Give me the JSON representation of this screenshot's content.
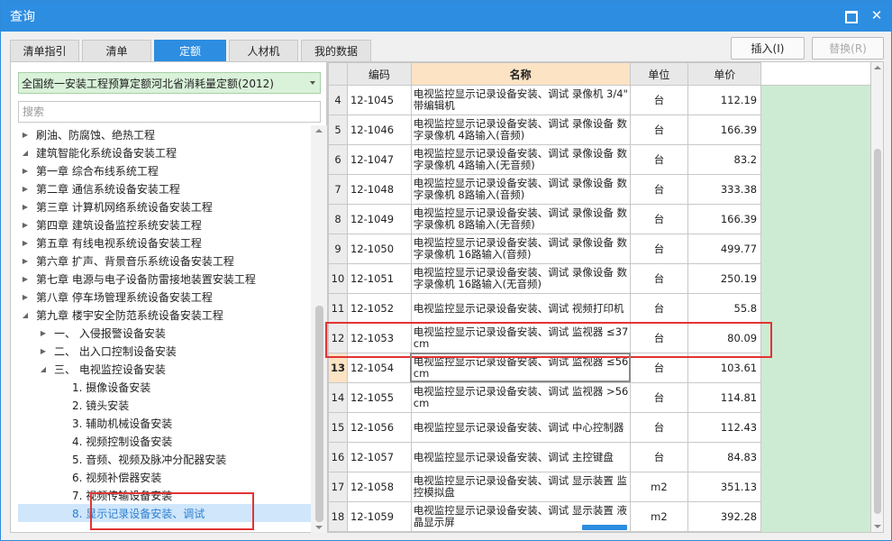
{
  "window": {
    "title": "查询"
  },
  "tabs": [
    "清单指引",
    "清单",
    "定额",
    "人材机",
    "我的数据"
  ],
  "buttons": {
    "insert": "插入(I)",
    "replace": "替换(R)"
  },
  "left": {
    "combo_value": "全国统一安装工程预算定额河北省消耗量定额(2012)",
    "search_placeholder": "搜索",
    "tree": [
      {
        "label": "刷油、防腐蚀、绝热工程",
        "level": 0,
        "expanded": false
      },
      {
        "label": "建筑智能化系统设备安装工程",
        "level": 0,
        "expanded": true
      },
      {
        "label": "第一章 综合布线系统工程",
        "level": 1,
        "expanded": false
      },
      {
        "label": "第二章 通信系统设备安装工程",
        "level": 1,
        "expanded": false
      },
      {
        "label": "第三章 计算机网络系统设备安装工程",
        "level": 1,
        "expanded": false
      },
      {
        "label": "第四章 建筑设备监控系统安装工程",
        "level": 1,
        "expanded": false
      },
      {
        "label": "第五章 有线电视系统设备安装工程",
        "level": 1,
        "expanded": false
      },
      {
        "label": "第六章 扩声、背景音乐系统设备安装工程",
        "level": 1,
        "expanded": false
      },
      {
        "label": "第七章 电源与电子设备防雷接地装置安装工程",
        "level": 1,
        "expanded": false
      },
      {
        "label": "第八章 停车场管理系统设备安装工程",
        "level": 1,
        "expanded": false
      },
      {
        "label": "第九章 楼宇安全防范系统设备安装工程",
        "level": 1,
        "expanded": true
      },
      {
        "label": "一、 入侵报警设备安装",
        "level": 2,
        "expanded": false
      },
      {
        "label": "二、 出入口控制设备安装",
        "level": 2,
        "expanded": false
      },
      {
        "label": "三、 电视监控设备安装",
        "level": 2,
        "expanded": true
      },
      {
        "label": "1. 摄像设备安装",
        "level": 3,
        "leaf": true
      },
      {
        "label": "2. 镜头安装",
        "level": 3,
        "leaf": true
      },
      {
        "label": "3. 辅助机械设备安装",
        "level": 3,
        "leaf": true
      },
      {
        "label": "4. 视频控制设备安装",
        "level": 3,
        "leaf": true
      },
      {
        "label": "5. 音频、视频及脉冲分配器安装",
        "level": 3,
        "leaf": true
      },
      {
        "label": "6. 视频补偿器安装",
        "level": 3,
        "leaf": true
      },
      {
        "label": "7. 视频传输设备安装",
        "level": 3,
        "leaf": true
      },
      {
        "label": "8. 显示记录设备安装、调试",
        "level": 3,
        "leaf": true,
        "selected": true
      }
    ]
  },
  "grid": {
    "headers": {
      "idx": "",
      "code": "编码",
      "name": "名称",
      "unit": "单位",
      "price": "单价"
    },
    "rows": [
      {
        "idx": "4",
        "code": "12-1045",
        "name": "电视监控显示记录设备安装、调试 录像机 3/4\" 带编辑机",
        "unit": "台",
        "price": "112.19"
      },
      {
        "idx": "5",
        "code": "12-1046",
        "name": "电视监控显示记录设备安装、调试 录像设备 数字录像机 4路输入(音频)",
        "unit": "台",
        "price": "166.39"
      },
      {
        "idx": "6",
        "code": "12-1047",
        "name": "电视监控显示记录设备安装、调试 录像设备 数字录像机 4路输入(无音频)",
        "unit": "台",
        "price": "83.2"
      },
      {
        "idx": "7",
        "code": "12-1048",
        "name": "电视监控显示记录设备安装、调试 录像设备 数字录像机 8路输入(音频)",
        "unit": "台",
        "price": "333.38"
      },
      {
        "idx": "8",
        "code": "12-1049",
        "name": "电视监控显示记录设备安装、调试 录像设备 数字录像机 8路输入(无音频)",
        "unit": "台",
        "price": "166.39"
      },
      {
        "idx": "9",
        "code": "12-1050",
        "name": "电视监控显示记录设备安装、调试 录像设备 数字录像机 16路输入(音频)",
        "unit": "台",
        "price": "499.77"
      },
      {
        "idx": "10",
        "code": "12-1051",
        "name": "电视监控显示记录设备安装、调试 录像设备 数字录像机 16路输入(无音频)",
        "unit": "台",
        "price": "250.19"
      },
      {
        "idx": "11",
        "code": "12-1052",
        "name": "电视监控显示记录设备安装、调试 视频打印机",
        "unit": "台",
        "price": "55.8"
      },
      {
        "idx": "12",
        "code": "12-1053",
        "name": "电视监控显示记录设备安装、调试 监视器 ≤37cm",
        "unit": "台",
        "price": "80.09"
      },
      {
        "idx": "13",
        "code": "12-1054",
        "name": "电视监控显示记录设备安装、调试 监视器 ≤56cm",
        "unit": "台",
        "price": "103.61",
        "current": true
      },
      {
        "idx": "14",
        "code": "12-1055",
        "name": "电视监控显示记录设备安装、调试 监视器 >56cm",
        "unit": "台",
        "price": "114.81"
      },
      {
        "idx": "15",
        "code": "12-1056",
        "name": "电视监控显示记录设备安装、调试 中心控制器",
        "unit": "台",
        "price": "112.43"
      },
      {
        "idx": "16",
        "code": "12-1057",
        "name": "电视监控显示记录设备安装、调试 主控键盘",
        "unit": "台",
        "price": "84.83"
      },
      {
        "idx": "17",
        "code": "12-1058",
        "name": "电视监控显示记录设备安装、调试 显示装置 监控模拟盘",
        "unit": "m2",
        "price": "351.13"
      },
      {
        "idx": "18",
        "code": "12-1059",
        "name": "电视监控显示记录设备安装、调试 显示装置 液晶显示屏",
        "unit": "m2",
        "price": "392.28"
      }
    ]
  }
}
